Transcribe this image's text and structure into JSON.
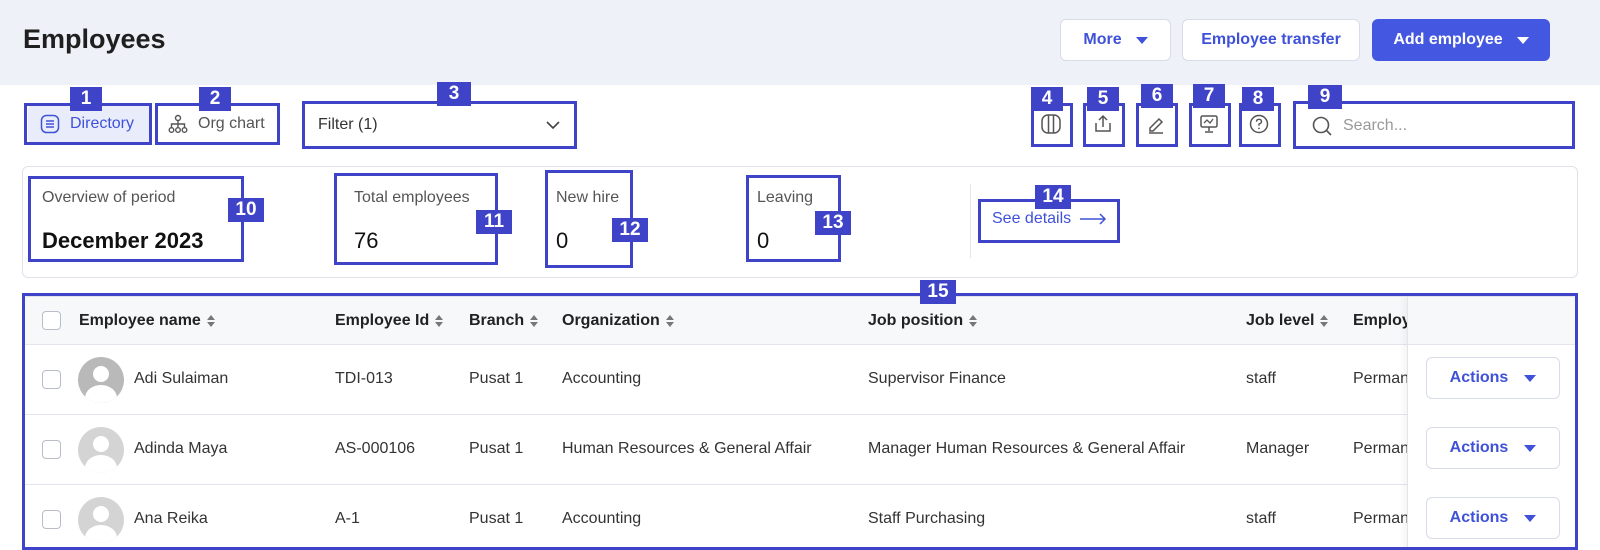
{
  "header": {
    "title": "Employees",
    "more_label": "More",
    "transfer_label": "Employee transfer",
    "add_label": "Add employee"
  },
  "views": {
    "directory": "Directory",
    "org_chart": "Org chart"
  },
  "filter": {
    "value": "Filter (1)"
  },
  "search": {
    "placeholder": "Search..."
  },
  "overview": {
    "period_label": "Overview of period",
    "period_value": "December 2023",
    "total_label": "Total employees",
    "total_value": "76",
    "newhire_label": "New hire",
    "newhire_value": "0",
    "leaving_label": "Leaving",
    "leaving_value": "0",
    "see_details": "See details"
  },
  "markers": [
    "1",
    "2",
    "3",
    "4",
    "5",
    "6",
    "7",
    "8",
    "9",
    "10",
    "11",
    "12",
    "13",
    "14",
    "15"
  ],
  "table": {
    "columns": [
      "Employee name",
      "Employee Id",
      "Branch",
      "Organization",
      "Job position",
      "Job level",
      "Employ"
    ],
    "rows": [
      {
        "name": "Adi Sulaiman",
        "id": "TDI-013",
        "branch": "Pusat 1",
        "org": "Accounting",
        "position": "Supervisor Finance",
        "level": "staff",
        "status": "Perman"
      },
      {
        "name": "Adinda Maya",
        "id": "AS-000106",
        "branch": "Pusat 1",
        "org": "Human Resources & General Affair",
        "position": "Manager Human Resources & General Affair",
        "level": "Manager",
        "status": "Perman"
      },
      {
        "name": "Ana Reika",
        "id": "A-1",
        "branch": "Pusat 1",
        "org": "Accounting",
        "position": "Staff Purchasing",
        "level": "staff",
        "status": "Perman"
      }
    ],
    "actions_label": "Actions"
  },
  "colors": {
    "accent": "#4357e0",
    "marker": "#3f43c8",
    "topbar": "#eef1f7"
  }
}
